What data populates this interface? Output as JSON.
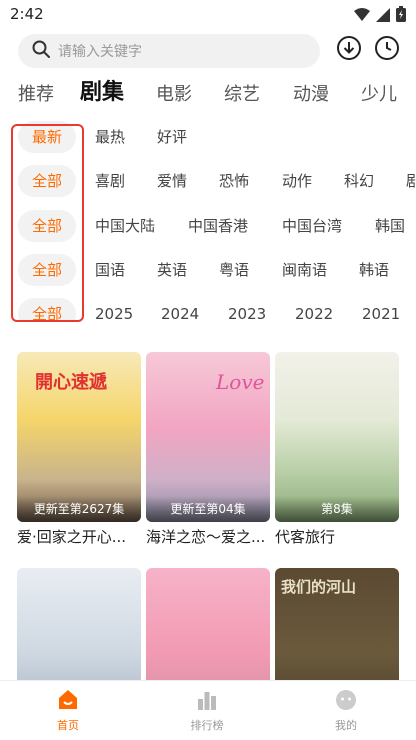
{
  "status": {
    "time": "2:42"
  },
  "search": {
    "placeholder": "请输入关键字"
  },
  "tabs": [
    "推荐",
    "剧集",
    "电影",
    "综艺",
    "动漫",
    "少儿"
  ],
  "active_tab": "剧集",
  "filters": {
    "sort": {
      "selected": "最新",
      "options": [
        "最热",
        "好评"
      ]
    },
    "genre": {
      "selected": "全部",
      "options": [
        "喜剧",
        "爱情",
        "恐怖",
        "动作",
        "科幻",
        "剧"
      ]
    },
    "region": {
      "selected": "全部",
      "options": [
        "中国大陆",
        "中国香港",
        "中国台湾",
        "韩国"
      ]
    },
    "language": {
      "selected": "全部",
      "options": [
        "国语",
        "英语",
        "粤语",
        "闽南语",
        "韩语"
      ]
    },
    "year": {
      "selected": "全部",
      "options": [
        "2025",
        "2024",
        "2023",
        "2022",
        "2021"
      ]
    }
  },
  "cards": [
    {
      "title": "爱·回家之开心...",
      "badge": "更新至第2627集",
      "poster_text": "開心速遞"
    },
    {
      "title": "海洋之恋～爱之...",
      "badge": "更新至第04集",
      "poster_text": "Love"
    },
    {
      "title": "代客旅行",
      "badge": "第8集",
      "poster_text": ""
    },
    {
      "title": "",
      "badge": "",
      "poster_text": ""
    },
    {
      "title": "",
      "badge": "",
      "poster_text": ""
    },
    {
      "title": "",
      "badge": "",
      "poster_text": "我们的河山"
    }
  ],
  "bottom_nav": [
    {
      "label": "首页",
      "icon": "home-icon"
    },
    {
      "label": "排行榜",
      "icon": "ranking-icon"
    },
    {
      "label": "我的",
      "icon": "profile-icon"
    }
  ],
  "colors": {
    "accent": "#ff6a00",
    "highlight_box": "#e83a2e"
  }
}
